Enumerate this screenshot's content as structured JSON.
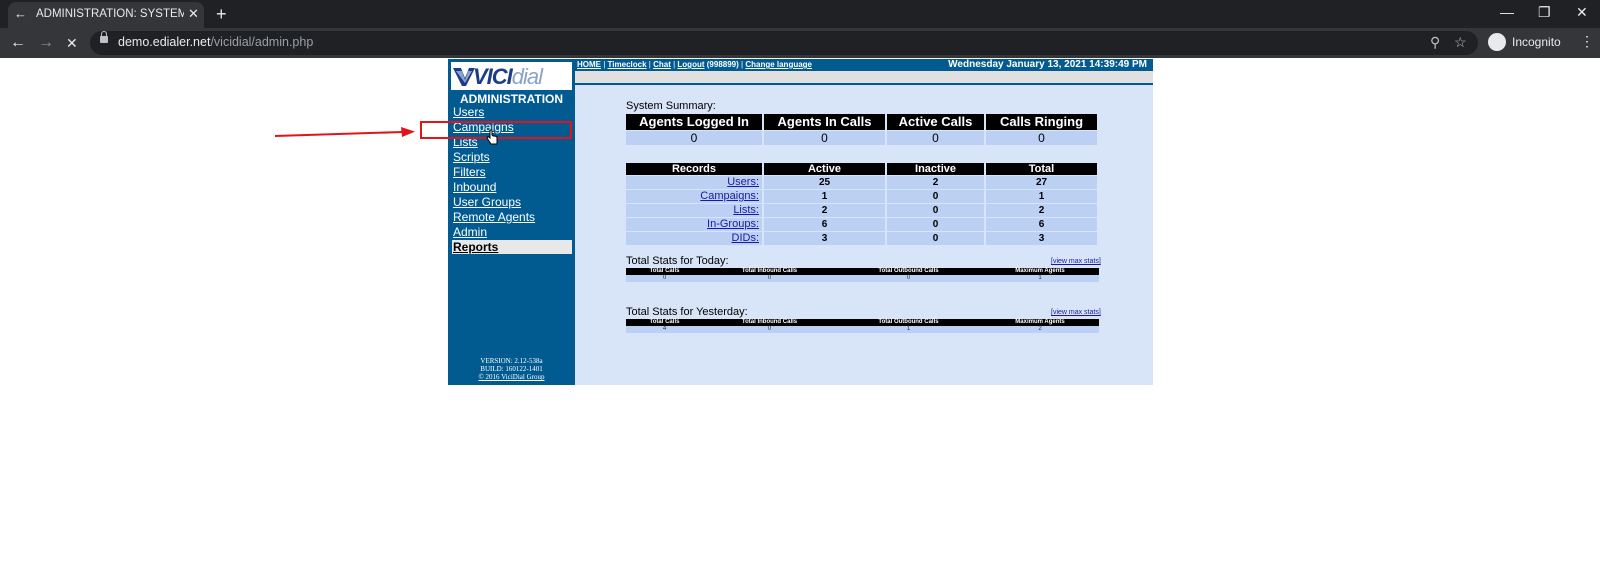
{
  "browser": {
    "tab_title": "ADMINISTRATION: SYSTEM SNAP",
    "url_host": "demo.edialer.net",
    "url_path": "/vicidial/admin.php",
    "profile_label": "Incognito"
  },
  "app": {
    "logo_brand": "VICI",
    "logo_suffix": "dial",
    "section_title": "ADMINISTRATION",
    "sidebar_items": [
      "Users",
      "Campaigns",
      "Lists",
      "Scripts",
      "Filters",
      "Inbound",
      "User Groups",
      "Remote Agents",
      "Admin",
      "Reports"
    ],
    "version": "VERSION: 2.12-538a",
    "build": "BUILD: 160122-1401",
    "copyright": "© 2016 ViciDial Group"
  },
  "topbar": {
    "links": [
      "HOME",
      "Timeclock",
      "Chat",
      "Logout",
      "Change language"
    ],
    "user_id": "(998899)",
    "datetime": "Wednesday January 13, 2021 14:39:49 PM"
  },
  "summary": {
    "title": "System Summary:",
    "headers": [
      "Agents Logged In",
      "Agents In Calls",
      "Active Calls",
      "Calls Ringing"
    ],
    "values": [
      "0",
      "0",
      "0",
      "0"
    ]
  },
  "records": {
    "headers": [
      "Records",
      "Active",
      "Inactive",
      "Total"
    ],
    "rows": [
      {
        "label": "Users:",
        "active": "25",
        "inactive": "2",
        "total": "27"
      },
      {
        "label": "Campaigns:",
        "active": "1",
        "inactive": "0",
        "total": "1"
      },
      {
        "label": "Lists:",
        "active": "2",
        "inactive": "0",
        "total": "2"
      },
      {
        "label": "In-Groups:",
        "active": "6",
        "inactive": "0",
        "total": "6"
      },
      {
        "label": "DIDs:",
        "active": "3",
        "inactive": "0",
        "total": "3"
      }
    ]
  },
  "today": {
    "title": "Total Stats for Today:",
    "link": "[view max stats]",
    "headers": [
      "Total Calls",
      "Total Inbound Calls",
      "Total Outbound Calls",
      "Maximum Agents"
    ],
    "values": [
      "0",
      "0",
      "0",
      "1"
    ]
  },
  "yesterday": {
    "title": "Total Stats for Yesterday:",
    "link": "[view max stats]",
    "headers": [
      "Total Calls",
      "Total Inbound Calls",
      "Total Outbound Calls",
      "Maximum Agents"
    ],
    "values": [
      "4",
      "0",
      "1",
      "2"
    ]
  },
  "colors": {
    "sidebar_blue": "#015b91",
    "content_bg": "#d8e4f8",
    "cell_bg": "#bcd0f4",
    "annotation_red": "#e0141a"
  }
}
